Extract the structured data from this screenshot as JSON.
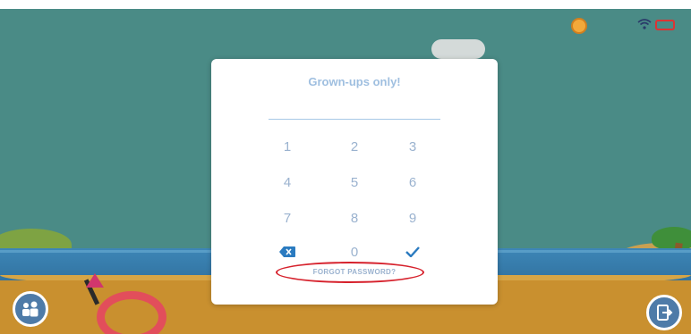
{
  "dialog": {
    "title": "Grown-ups only!",
    "forgot_label": "FORGOT PASSWORD?"
  },
  "keypad": {
    "keys": [
      "1",
      "2",
      "3",
      "4",
      "5",
      "6",
      "7",
      "8",
      "9",
      "⌫",
      "0",
      "✓"
    ]
  },
  "icons": {
    "backspace": "backspace-icon",
    "confirm": "checkmark-icon",
    "kids": "kids-profile-icon",
    "exit": "exit-icon",
    "coin": "coin-icon",
    "wifi": "wifi-icon",
    "battery": "battery-icon"
  },
  "colors": {
    "scene_background": "#4a8b86",
    "dialog_text": "#9ab2cf",
    "highlight_ellipse": "#d6212c"
  }
}
